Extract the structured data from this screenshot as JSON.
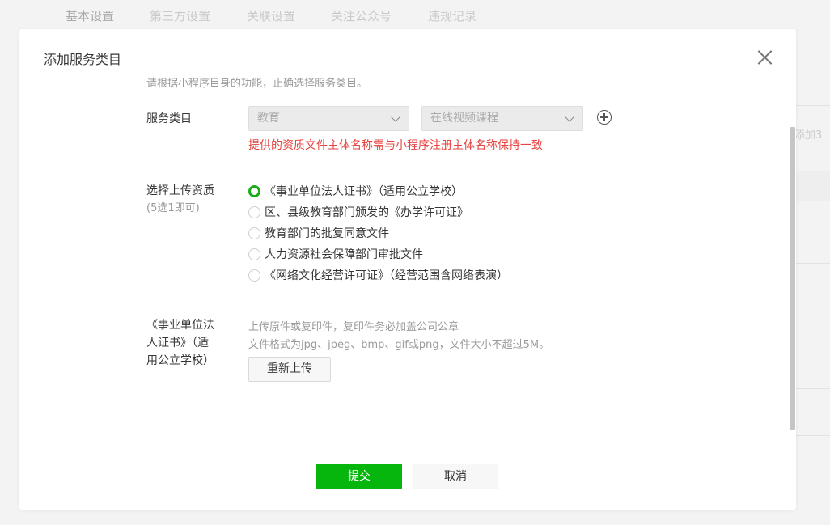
{
  "background": {
    "tabs": [
      "基本设置",
      "第三方设置",
      "关联设置",
      "关注公众号",
      "违规记录"
    ],
    "side_text": "添加3"
  },
  "dialog": {
    "title": "添加服务类目",
    "hint": "请根据小程序目身的功能，止确选择服务类目。",
    "service_category": {
      "label": "服务类目",
      "primary_value": "教育",
      "secondary_value": "在线视频课程",
      "error": "提供的资质文件主体名称需与小程序注册主体名称保持一致"
    },
    "qualification": {
      "label": "选择上传资质",
      "sub_label": "(5选1即可)",
      "selected_index": 0,
      "options": [
        "《事业单位法人证书》（适用公立学校）",
        "区、县级教育部门颁发的《办学许可证》",
        "教育部门的批复同意文件",
        "人力资源社会保障部门审批文件",
        "《网络文化经营许可证》（经营范围含网络表演）"
      ]
    },
    "upload": {
      "label_lines": [
        "《事业单位法",
        "人证书》（适",
        "用公立学校）"
      ],
      "desc_line1": "上传原件或复印件，复印件务必加盖公司公章",
      "desc_line2": "文件格式为jpg、jpeg、bmp、gif或png，文件大小不超过5M。",
      "button": "重新上传"
    },
    "submit": "提交",
    "cancel": "取消"
  },
  "colors": {
    "accent_green": "#07b60d",
    "error_red": "#e64340"
  }
}
